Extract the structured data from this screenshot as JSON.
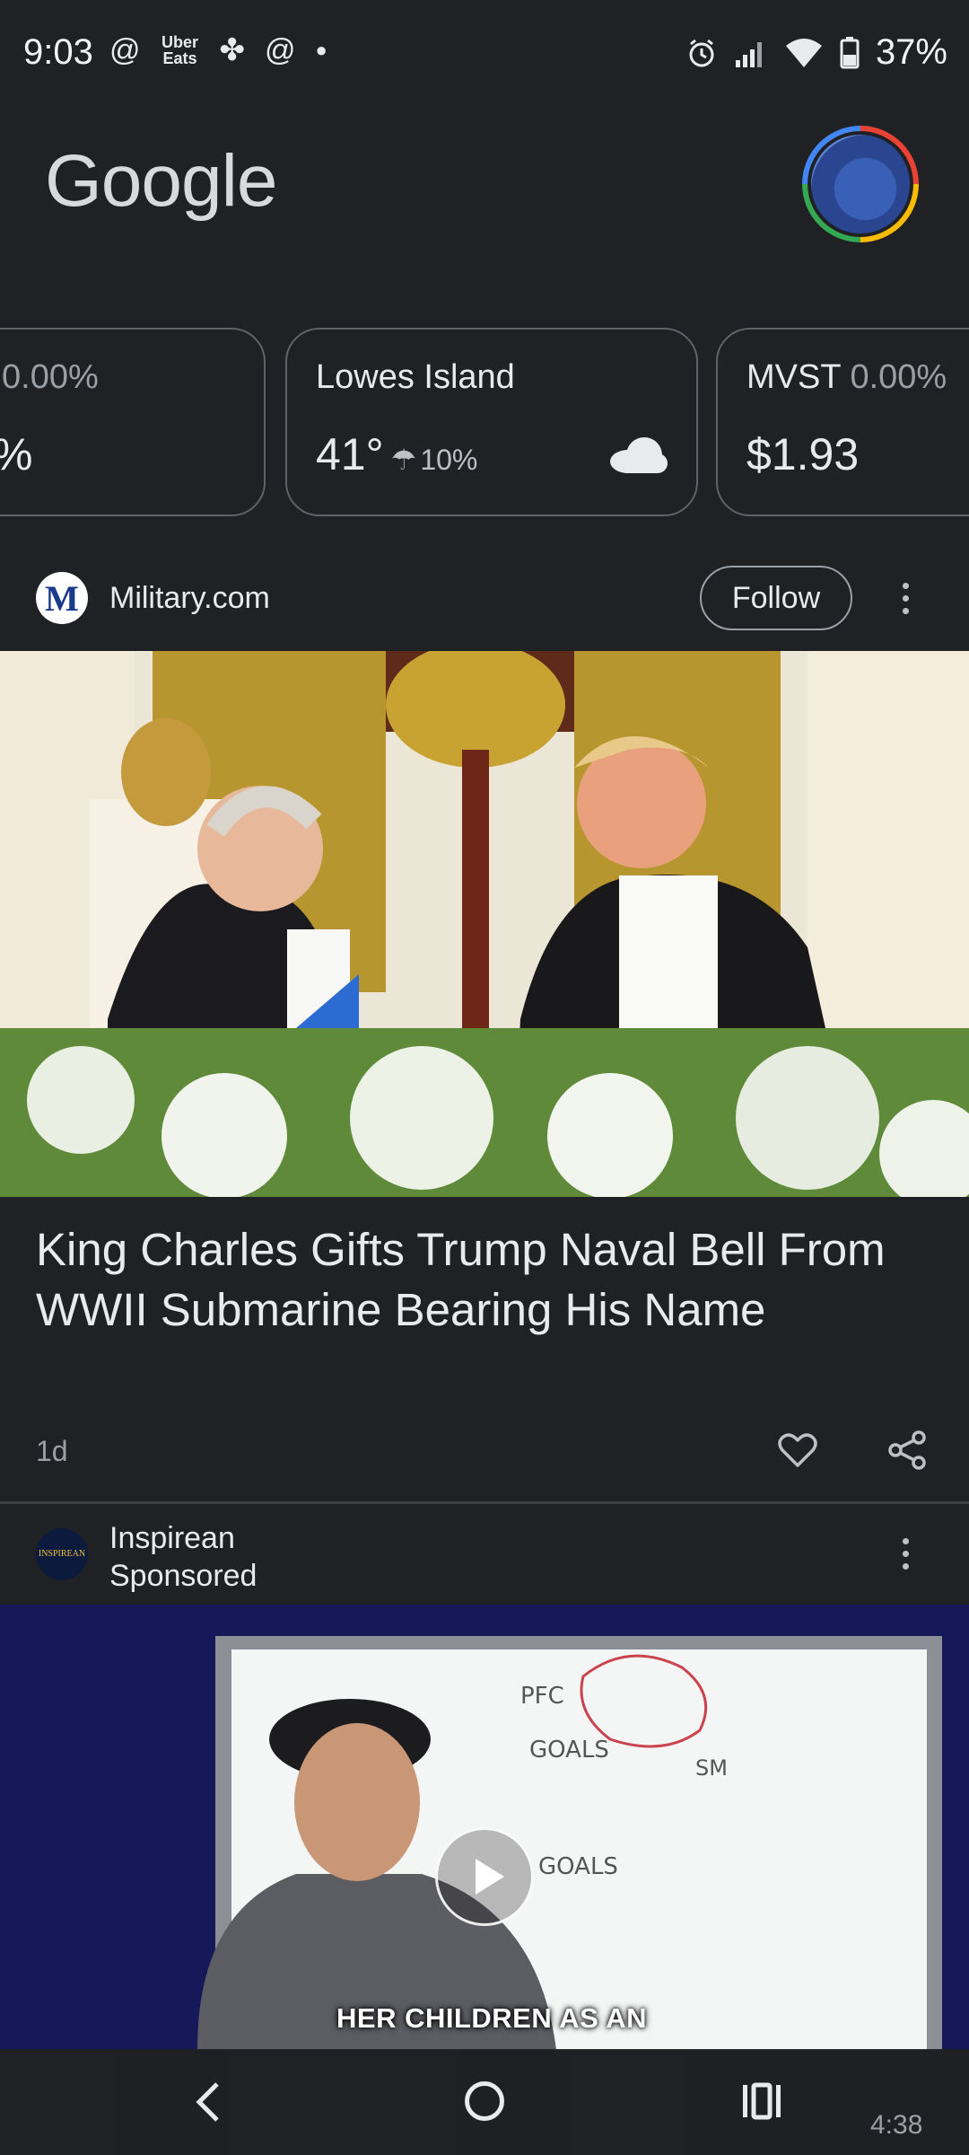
{
  "status_bar": {
    "time": "9:03",
    "app_icons": [
      "threads-icon",
      "uber-eats-icon",
      "pinwheel-icon",
      "threads-icon",
      "dot-icon"
    ],
    "uber_label": "Uber\nEats",
    "battery": "37%"
  },
  "header": {
    "logo": "Google"
  },
  "cards": [
    {
      "title": "",
      "change": "0.00%",
      "value": "%"
    },
    {
      "title": "Lowes Island",
      "temp": "41°",
      "precip": "10%",
      "icon": "cloud-icon"
    },
    {
      "title": "MVST",
      "change": "0.00%",
      "value": "$1.93"
    }
  ],
  "article": {
    "publisher": "Military.com",
    "publisher_initial": "M",
    "follow_label": "Follow",
    "headline": "King Charles Gifts Trump Naval Bell From WWII Submarine Bearing His Name",
    "age": "1d"
  },
  "sponsored": {
    "publisher": "Inspirean",
    "label": "Sponsored",
    "logo_text": "INSPIREAN",
    "caption": "HER CHILDREN AS AN",
    "duration": "4:38"
  },
  "colors": {
    "background": "#202124",
    "card_border": "#5f6368",
    "text": "#e8eaed",
    "muted": "#9aa0a6"
  }
}
